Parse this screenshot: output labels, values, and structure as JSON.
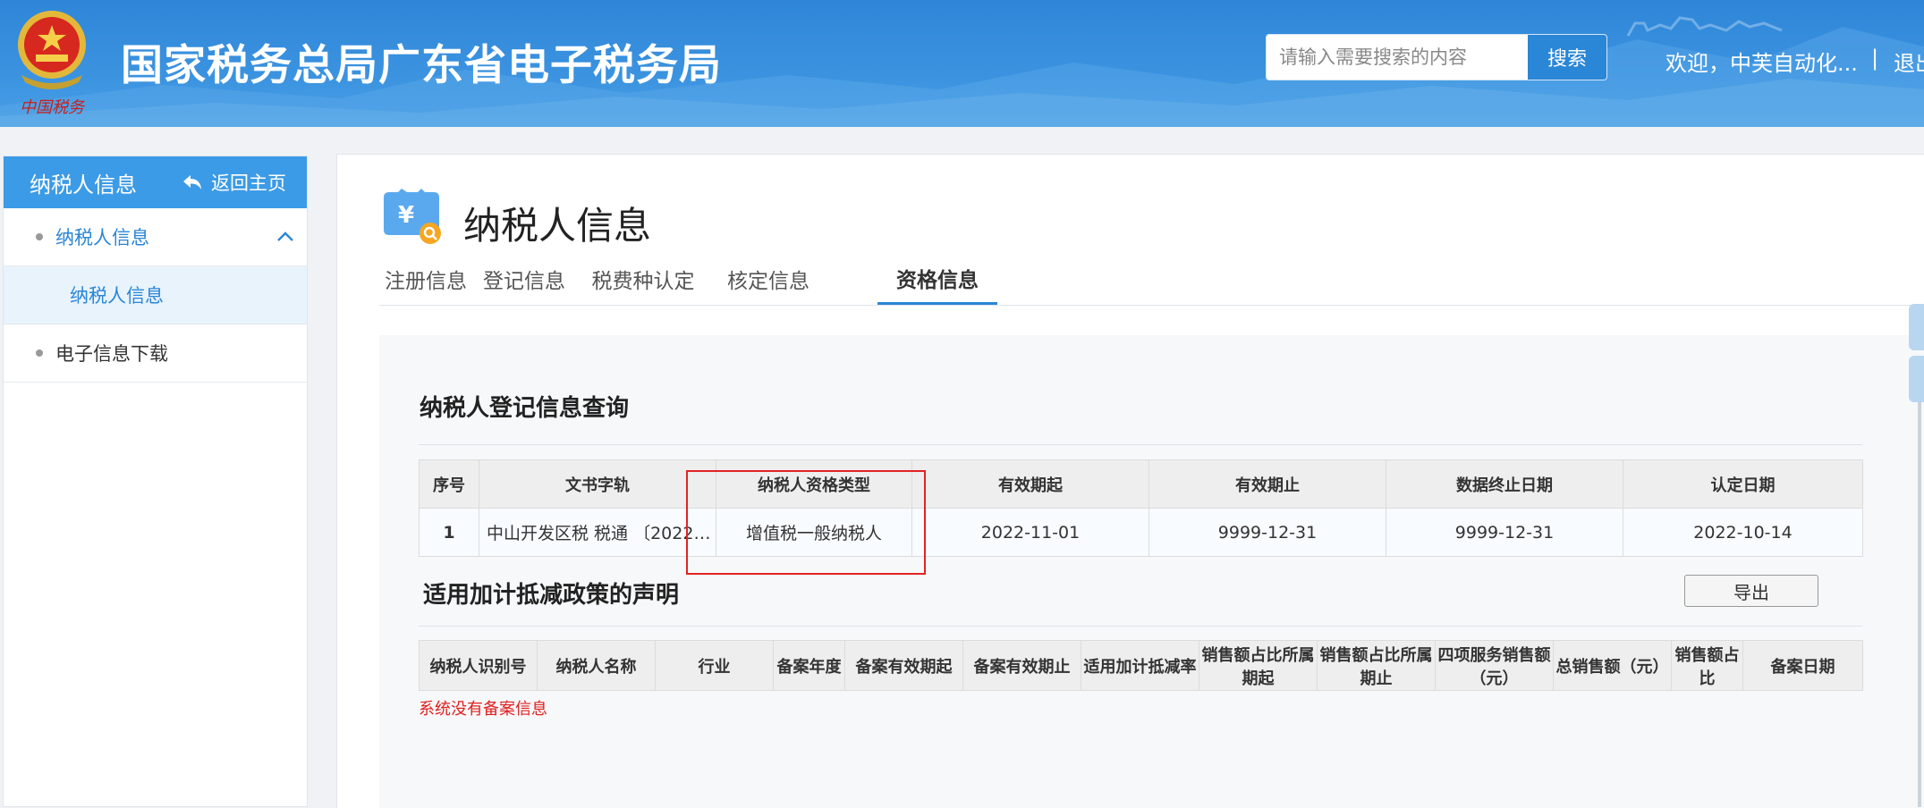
{
  "header": {
    "title": "国家税务总局广东省电子税务局",
    "search_placeholder": "请输入需要搜索的内容",
    "search_button": "搜索",
    "welcome": "欢迎，中芙自动化...",
    "separator": "|",
    "logout": "退出",
    "emblem_text": "中国税务"
  },
  "sidebar": {
    "title": "纳税人信息",
    "back_label": "返回主页",
    "items": [
      {
        "label": "纳税人信息",
        "expanded": true,
        "children": [
          {
            "label": "纳税人信息",
            "selected": true
          }
        ]
      },
      {
        "label": "电子信息下载",
        "expanded": false
      }
    ]
  },
  "main": {
    "page_title": "纳税人信息",
    "tabs": [
      {
        "label": "注册信息",
        "active": false
      },
      {
        "label": "登记信息",
        "active": false
      },
      {
        "label": "税费种认定",
        "active": false
      },
      {
        "label": "核定信息",
        "active": false
      },
      {
        "label": "资格信息",
        "active": true
      }
    ]
  },
  "section1": {
    "title": "纳税人登记信息查询",
    "columns": [
      "序号",
      "文书字轨",
      "纳税人资格类型",
      "有效期起",
      "有效期止",
      "数据终止日期",
      "认定日期"
    ],
    "rows": [
      [
        "1",
        "中山开发区税 税通 〔2022〕...",
        "增值税一般纳税人",
        "2022-11-01",
        "9999-12-31",
        "9999-12-31",
        "2022-10-14"
      ]
    ]
  },
  "section2": {
    "title": "适用加计抵减政策的声明",
    "export_label": "导出",
    "columns": [
      "纳税人识别号",
      "纳税人名称",
      "行业",
      "备案年度",
      "备案有效期起",
      "备案有效期止",
      "适用加计抵减率",
      "销售额占比所属期起",
      "销售额占比所属期止",
      "四项服务销售额（元）",
      "总销售额（元）",
      "销售额占比",
      "备案日期"
    ],
    "empty_message": "系统没有备案信息"
  },
  "colors": {
    "header_blue": "#2f86d8",
    "accent": "#2a86d6",
    "sidebar_head": "#3c9be6",
    "highlight_red": "#e02424",
    "error_red": "#e02020"
  }
}
